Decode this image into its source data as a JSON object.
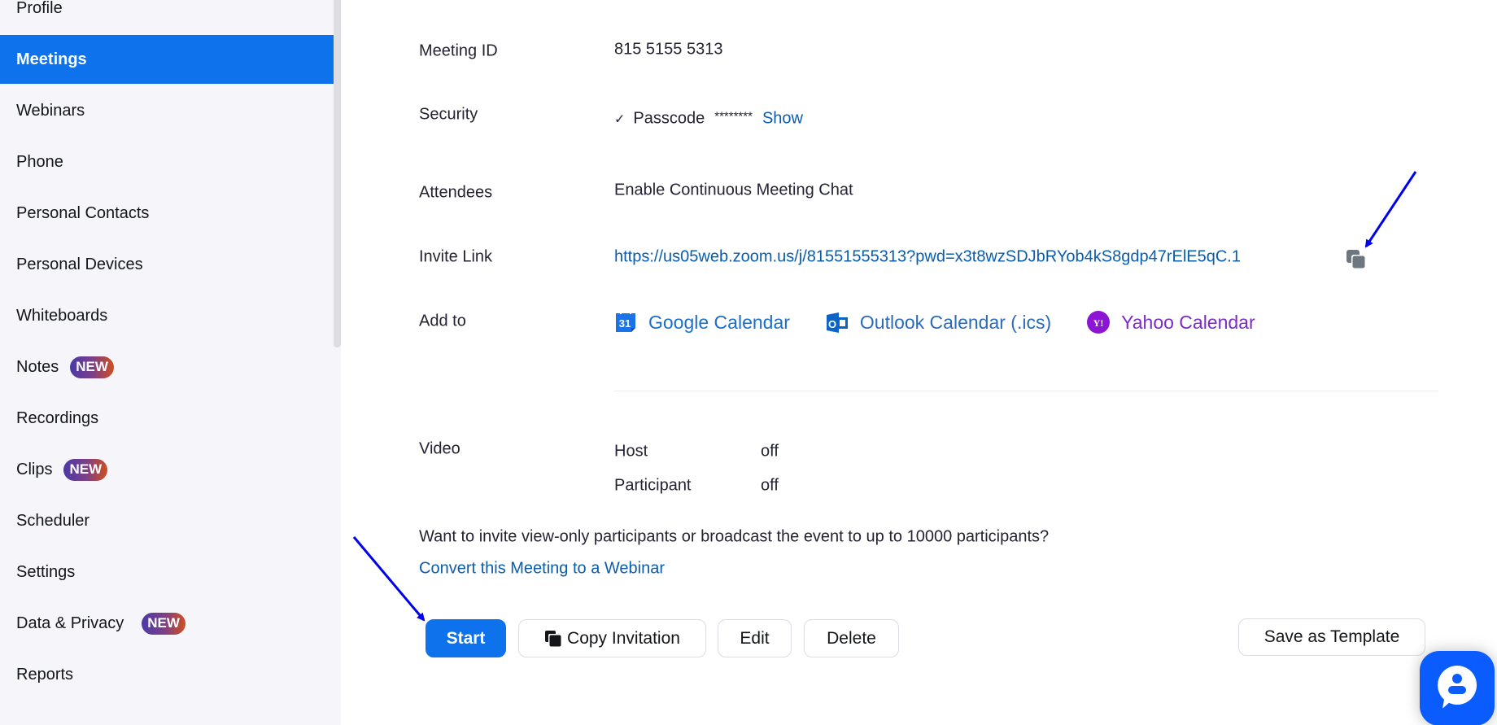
{
  "sidebar": {
    "items": [
      {
        "label": "Profile",
        "active": false,
        "badge": null
      },
      {
        "label": "Meetings",
        "active": true,
        "badge": null
      },
      {
        "label": "Webinars",
        "active": false,
        "badge": null
      },
      {
        "label": "Phone",
        "active": false,
        "badge": null
      },
      {
        "label": "Personal Contacts",
        "active": false,
        "badge": null
      },
      {
        "label": "Personal Devices",
        "active": false,
        "badge": null
      },
      {
        "label": "Whiteboards",
        "active": false,
        "badge": null
      },
      {
        "label": "Notes",
        "active": false,
        "badge": "NEW"
      },
      {
        "label": "Recordings",
        "active": false,
        "badge": null
      },
      {
        "label": "Clips",
        "active": false,
        "badge": "NEW"
      },
      {
        "label": "Scheduler",
        "active": false,
        "badge": null
      },
      {
        "label": "Settings",
        "active": false,
        "badge": null
      },
      {
        "label": "Data & Privacy",
        "active": false,
        "badge": "NEW"
      },
      {
        "label": "Reports",
        "active": false,
        "badge": null
      }
    ]
  },
  "meeting": {
    "meeting_id_label": "Meeting ID",
    "meeting_id": "815 5155 5313",
    "security_label": "Security",
    "security": {
      "check": "✓",
      "passcode_label": "Passcode",
      "passcode_masked": "********",
      "show_link": "Show"
    },
    "attendees_label": "Attendees",
    "attendees_value": "Enable Continuous Meeting Chat",
    "invite_link_label": "Invite Link",
    "invite_link": "https://us05web.zoom.us/j/81551555313?pwd=x3t8wzSDJbRYob4kS8gdp47rElE5qC.1",
    "add_to_label": "Add to",
    "calendars": {
      "google": "Google Calendar",
      "google_icon_text": "31",
      "outlook": "Outlook Calendar (.ics)",
      "outlook_icon_text": "O",
      "yahoo": "Yahoo Calendar",
      "yahoo_icon_text": "Y!"
    },
    "video_label": "Video",
    "video": {
      "host_label": "Host",
      "host_value": "off",
      "participant_label": "Participant",
      "participant_value": "off"
    },
    "promo_text": "Want to invite view-only participants or broadcast the event to up to 10000 participants?",
    "convert_link": "Convert this Meeting to a Webinar"
  },
  "actions": {
    "start": "Start",
    "copy_invitation": "Copy Invitation",
    "edit": "Edit",
    "delete": "Delete",
    "save_as_template": "Save as Template"
  },
  "colors": {
    "accent": "#0e72ed",
    "link": "#0b5cad",
    "yahoo": "#7b2cc4",
    "annotation_arrow": "#0000ee"
  }
}
